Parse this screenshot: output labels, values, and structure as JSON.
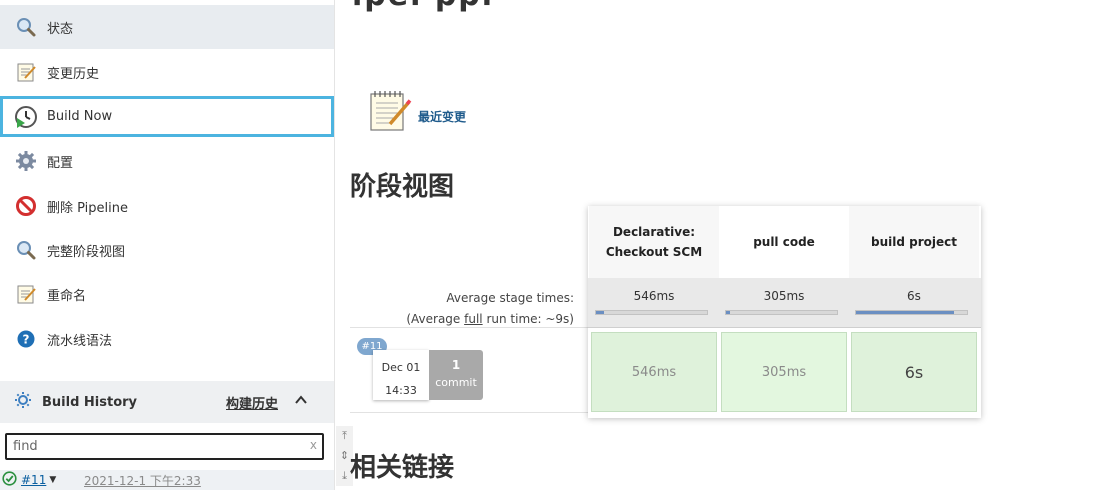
{
  "sidebar": {
    "items": [
      {
        "label": "状态",
        "icon": "search-icon"
      },
      {
        "label": "变更历史",
        "icon": "notepad-icon"
      },
      {
        "label": "Build Now",
        "icon": "clock-play-icon"
      },
      {
        "label": "配置",
        "icon": "gear-icon"
      },
      {
        "label": "删除 Pipeline",
        "icon": "no-entry-icon"
      },
      {
        "label": "完整阶段视图",
        "icon": "search-icon"
      },
      {
        "label": "重命名",
        "icon": "notepad-icon"
      },
      {
        "label": "流水线语法",
        "icon": "help-icon"
      }
    ]
  },
  "build_history": {
    "title": "Build History",
    "trend_link": "构建历史",
    "filter_placeholder": "find",
    "filter_clear": "x",
    "rows": [
      {
        "number": "#11",
        "date": "2021-12-1 下午2:33",
        "status_icon": "success-check-icon"
      }
    ]
  },
  "main": {
    "title_fragment": "ipel ppl",
    "changes_link": "最近变更",
    "stage_view_heading": "阶段视图",
    "related_links_heading": "相关链接",
    "stage_view": {
      "avg_label_line1": "Average stage times:",
      "avg_label_line2_prefix": "(Average ",
      "avg_label_line2_link": "full",
      "avg_label_line2_suffix": " run time: ~9s)",
      "stages": [
        {
          "name": "Declarative: Checkout SCM",
          "avg": "546ms",
          "result": "546ms",
          "bar_fraction": 0.07
        },
        {
          "name": "pull code",
          "avg": "305ms",
          "result": "305ms",
          "bar_fraction": 0.04
        },
        {
          "name": "build project",
          "avg": "6s",
          "result": "6s",
          "bar_fraction": 0.88
        }
      ],
      "run": {
        "badge": "#11",
        "date": "Dec 01",
        "time": "14:33",
        "commit_count": "1",
        "commit_label": "commit"
      }
    }
  },
  "colors": {
    "focus_border": "#4cb4e0",
    "stage_success": "#dff2db",
    "link": "#1f5b8c"
  }
}
